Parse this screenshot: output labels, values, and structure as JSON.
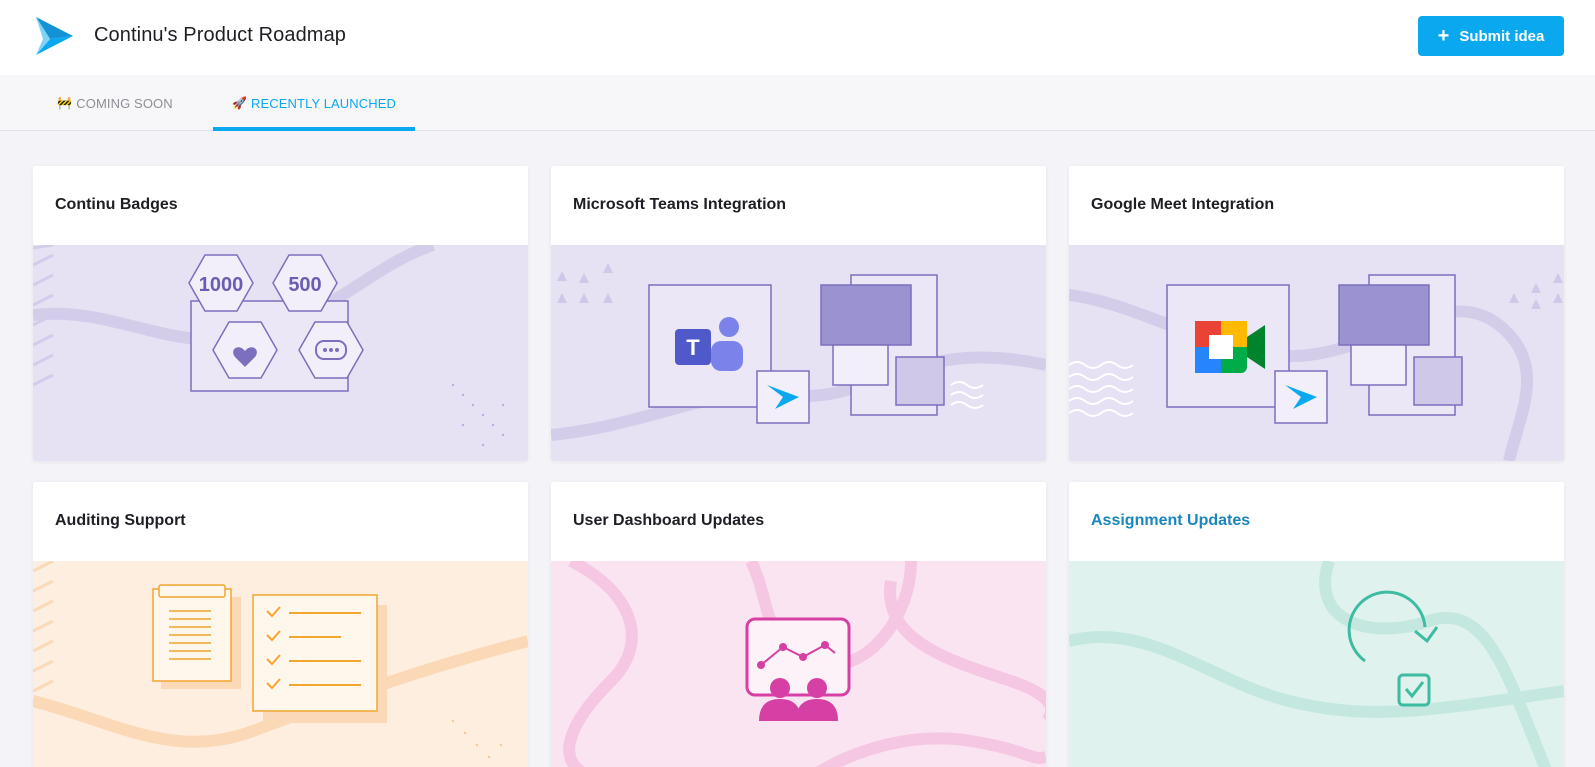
{
  "app": {
    "title": "Continu's Product Roadmap",
    "accent_color": "#0aa9ef"
  },
  "header": {
    "logo_icon": "continu-arrow-logo",
    "submit_button": {
      "icon": "plus-icon",
      "label": "Submit idea"
    }
  },
  "tabs": [
    {
      "emoji": "🚧",
      "label": "COMING SOON",
      "active": false
    },
    {
      "emoji": "🚀",
      "label": "RECENTLY LAUNCHED",
      "active": true
    }
  ],
  "cards": [
    {
      "title": "Continu Badges",
      "illustration": "badges-illustration",
      "badge_values": [
        "1000",
        "500"
      ],
      "theme": "#e6e2f4"
    },
    {
      "title": "Microsoft Teams Integration",
      "illustration": "teams-integration-illustration",
      "theme": "#e6e2f4"
    },
    {
      "title": "Google Meet Integration",
      "illustration": "google-meet-integration-illustration",
      "theme": "#e6e2f4"
    },
    {
      "title": "Auditing Support",
      "illustration": "auditing-illustration",
      "theme": "#fdeee0"
    },
    {
      "title": "User Dashboard Updates",
      "illustration": "dashboard-illustration",
      "theme": "#fbe4f2"
    },
    {
      "title": "Assignment Updates",
      "illustration": "assignment-illustration",
      "theme": "#dff2ee",
      "hovered": true
    }
  ]
}
